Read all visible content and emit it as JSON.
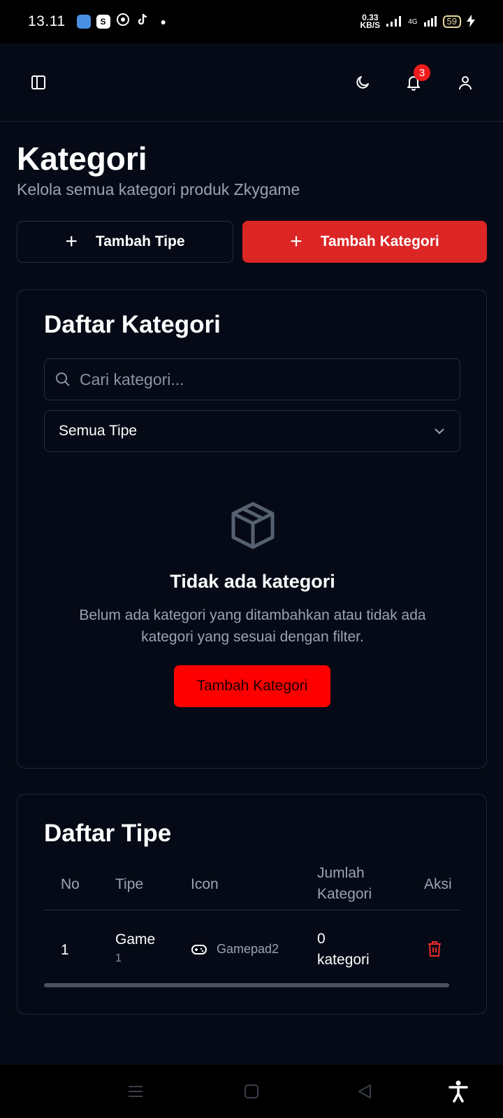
{
  "status_bar": {
    "time": "13.11",
    "speed_value": "0.33",
    "speed_unit": "KB/S",
    "network": "4G",
    "battery": "59"
  },
  "header": {
    "notification_count": "3"
  },
  "page": {
    "title": "Kategori",
    "subtitle": "Kelola semua kategori produk Zkygame"
  },
  "actions": {
    "add_type_label": "Tambah Tipe",
    "add_category_label": "Tambah Kategori"
  },
  "category_list": {
    "title": "Daftar Kategori",
    "search_placeholder": "Cari kategori...",
    "type_filter_selected": "Semua Tipe",
    "empty_title": "Tidak ada kategori",
    "empty_text": "Belum ada kategori yang ditambahkan atau tidak ada kategori yang sesuai dengan filter.",
    "empty_button_label": "Tambah Kategori"
  },
  "type_list": {
    "title": "Daftar Tipe",
    "columns": {
      "no": "No",
      "type": "Tipe",
      "icon": "Icon",
      "count_line1": "Jumlah",
      "count_line2": "Kategori",
      "action": "Aksi"
    },
    "rows": [
      {
        "no": "1",
        "name": "Game",
        "sub": "1",
        "icon_name": "Gamepad2",
        "count_line1": "0",
        "count_line2": "kategori"
      }
    ]
  },
  "colors": {
    "background": "#050a16",
    "accent_red": "#dc2626",
    "empty_button_red": "#ff0000",
    "muted_text": "#9aa3b5"
  }
}
